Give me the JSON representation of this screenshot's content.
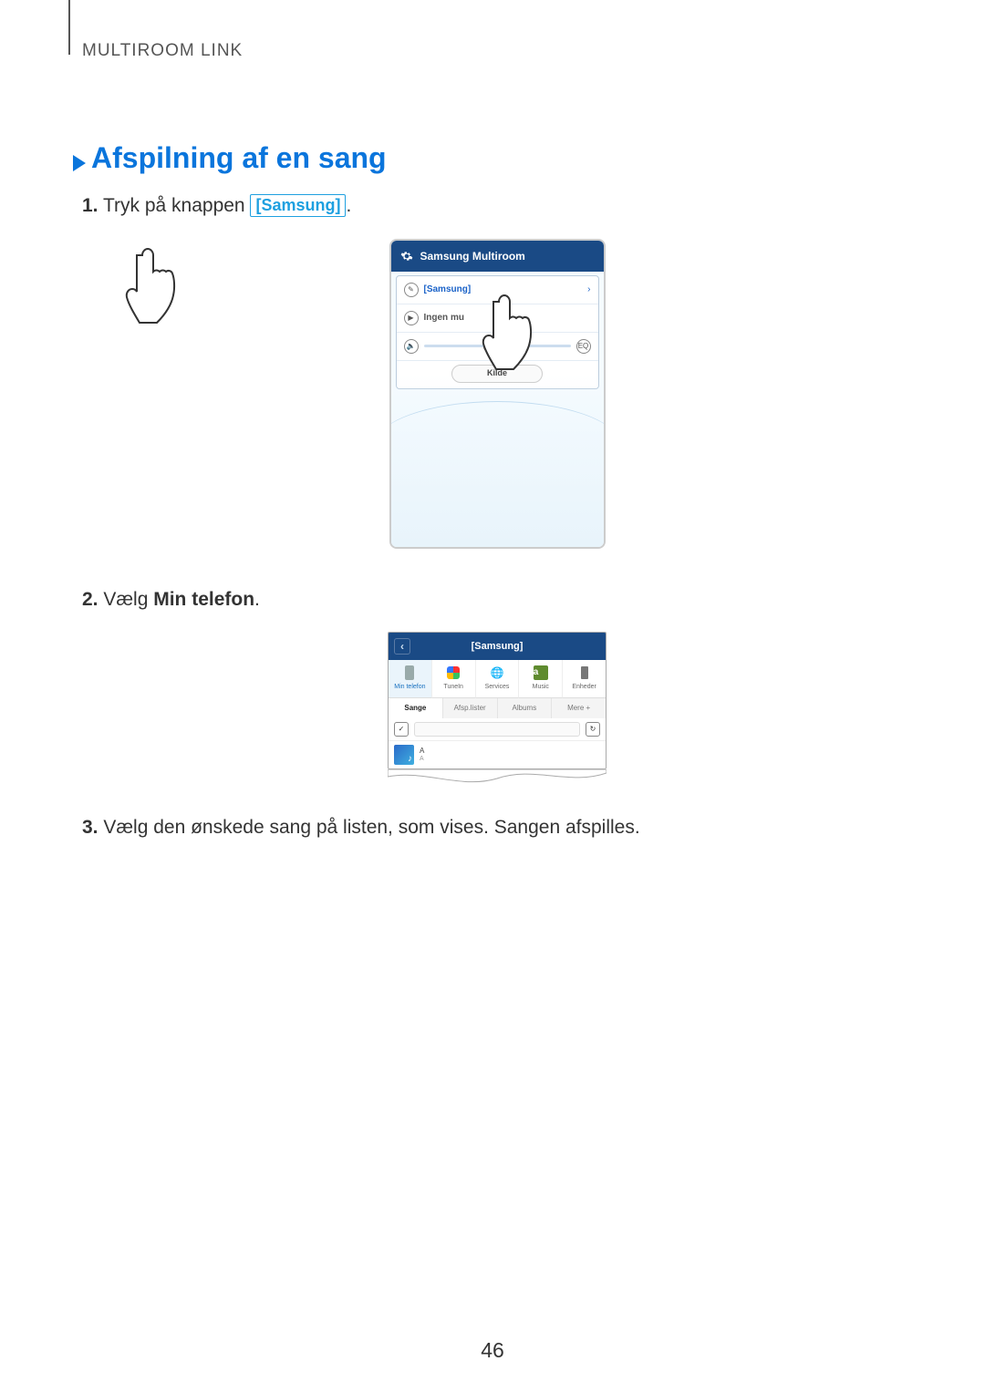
{
  "header": "MULTIROOM LINK",
  "title": "Afspilning af en sang",
  "step1": {
    "num": "1.",
    "pre": " Tryk på knappen ",
    "chip": "[Samsung]",
    "post": "."
  },
  "step2": {
    "num": "2.",
    "pre": " Vælg ",
    "bold": "Min telefon",
    "post": "."
  },
  "step3": {
    "num": "3.",
    "text": " Vælg den ønskede sang på listen, som vises. Sangen afspilles."
  },
  "fig1": {
    "topbar": "Samsung Multiroom",
    "row_samsung": "[Samsung]",
    "row_no_music": "Ingen mu",
    "eq": "EQ",
    "kilde": "Kilde",
    "chevron": "›"
  },
  "fig2": {
    "top": "[Samsung]",
    "back": "‹",
    "sources": {
      "my_phone": "Min telefon",
      "tunein": "TuneIn",
      "services": "Services",
      "music": "Music",
      "devices": "Enheder",
      "amazon_letter": "a"
    },
    "filters": {
      "songs": "Sange",
      "playlists": "Afsp.lister",
      "albums": "Albums",
      "more": "Mere +"
    },
    "check": "✓",
    "refresh": "↻",
    "song": {
      "title": "A",
      "artist": "A"
    }
  },
  "page_number": "46"
}
